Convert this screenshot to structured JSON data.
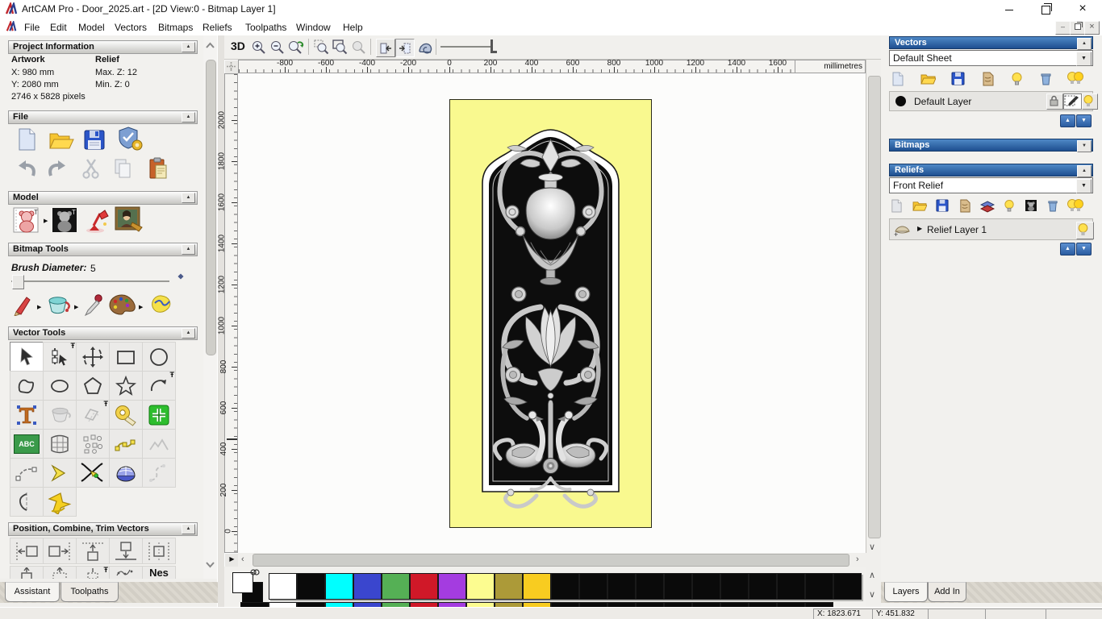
{
  "window": {
    "title": "ArtCAM Pro - Door_2025.art - [2D View:0 - Bitmap Layer 1]"
  },
  "menu": {
    "items": [
      "File",
      "Edit",
      "Model",
      "Vectors",
      "Bitmaps",
      "Reliefs",
      "Toolpaths",
      "Window",
      "Help"
    ]
  },
  "glyphs": {
    "collapse": "▲",
    "expand": "▼",
    "flyout": "▶",
    "pin": "Ŧ",
    "left": "‹",
    "right": "›",
    "up": "∧",
    "down": "∨",
    "close": "×",
    "minimize": "–",
    "up_solid": "▲",
    "down_solid": "▼",
    "right_solid": "▶"
  },
  "assistant": {
    "project": {
      "title": "Project Information",
      "artwork_label": "Artwork",
      "relief_label": "Relief",
      "x": "X: 980 mm",
      "y": "Y: 2080 mm",
      "max_z": "Max. Z: 12",
      "min_z": "Min. Z: 0",
      "pixels": "2746 x 5828 pixels"
    },
    "file_title": "File",
    "model_title": "Model",
    "bitmap_title": "Bitmap Tools",
    "brush_label": "Brush Diameter:",
    "brush_value": "5",
    "vector_title": "Vector Tools",
    "position_title": "Position, Combine, Trim Vectors",
    "abc": "ABC",
    "nes": "Nes",
    "tabs": [
      "Assistant",
      "Toolpaths"
    ]
  },
  "canvas": {
    "btn_3d": "3D",
    "units": "millimetres",
    "h_ticks": [
      "-800",
      "-600",
      "-400",
      "-200",
      "0",
      "200",
      "400",
      "600",
      "800",
      "1000",
      "1200",
      "1400",
      "1600"
    ],
    "v_ticks": [
      "2000",
      "1800",
      "1600",
      "1400",
      "1200",
      "1000",
      "800",
      "600",
      "400",
      "200",
      "0"
    ]
  },
  "vectors_panel": {
    "title": "Vectors",
    "sheet": "Default Sheet",
    "layer": "Default Layer"
  },
  "bitmaps_panel": {
    "title": "Bitmaps"
  },
  "reliefs_panel": {
    "title": "Reliefs",
    "relief": "Front Relief",
    "layer": "Relief Layer 1"
  },
  "right_tabs": [
    "Layers",
    "Add In"
  ],
  "palette": {
    "primary": "#ffffff",
    "secondary": "#0a0a0a",
    "row1": [
      "#ffffff",
      "#0a0a0a",
      "#00ffff",
      "#3a46ce",
      "#55b055",
      "#d01828",
      "#a43ce0",
      "#fcfc90",
      "#ac9a38",
      "#f8cc20",
      "#0a0a0a",
      "#0a0a0a",
      "#0a0a0a",
      "#0a0a0a",
      "#0a0a0a",
      "#0a0a0a",
      "#0a0a0a",
      "#0a0a0a",
      "#0a0a0a",
      "#0a0a0a",
      "#0a0a0a"
    ],
    "row2": [
      "#0a0a0a",
      "#ffffff",
      "#0a0a0a",
      "#00ffff",
      "#3a46ce",
      "#55b055",
      "#d01828",
      "#a43ce0",
      "#fcfc90",
      "#ac9a38",
      "#f8cc20",
      "#0a0a0a",
      "#0a0a0a",
      "#0a0a0a",
      "#0a0a0a",
      "#0a0a0a",
      "#0a0a0a",
      "#0a0a0a",
      "#0a0a0a",
      "#0a0a0a",
      "#0a0a0a"
    ]
  },
  "status": {
    "x": "X: 1823.671",
    "y": "Y: 451.832"
  },
  "artwork": {
    "background": "#f9f98f"
  }
}
